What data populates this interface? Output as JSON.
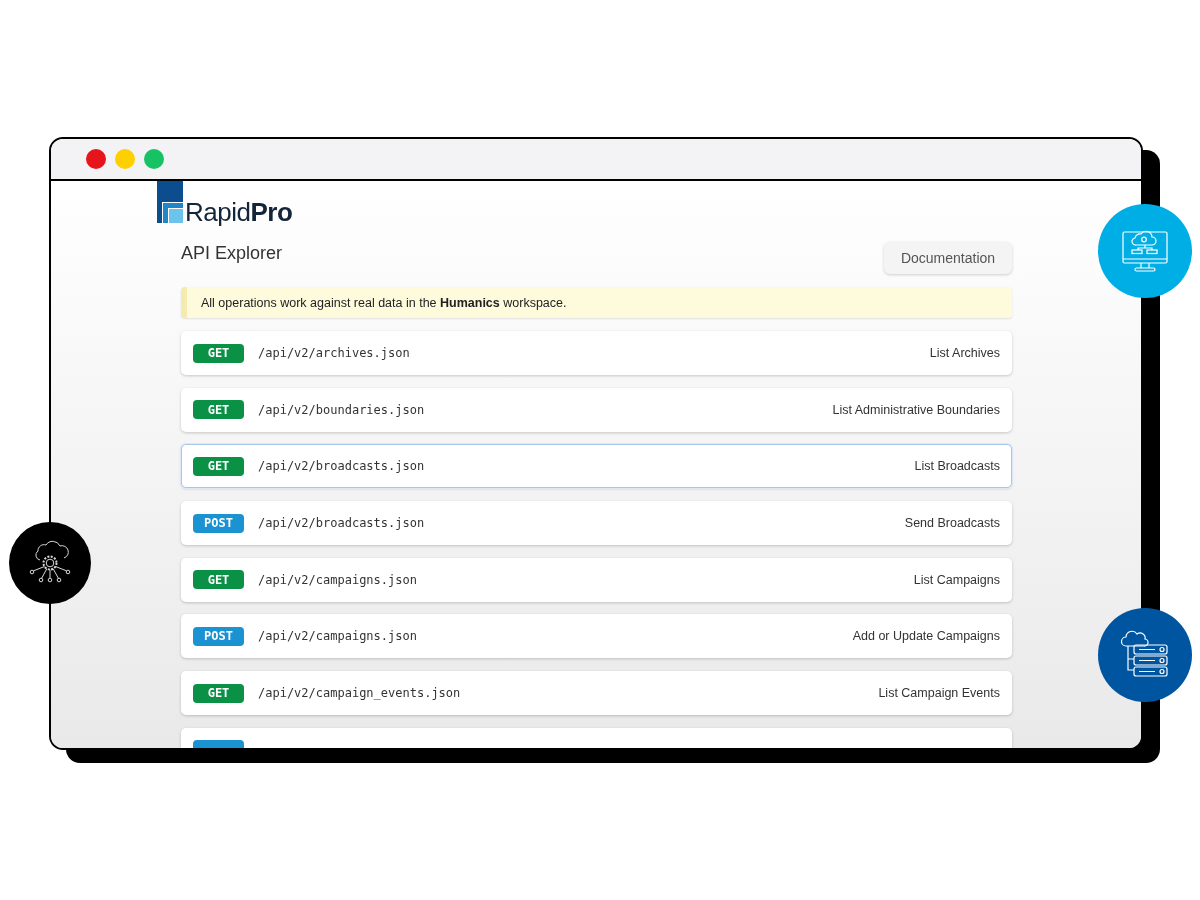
{
  "window": {
    "controls": [
      {
        "color": "#e8141c"
      },
      {
        "color": "#ffd000"
      },
      {
        "color": "#17c265"
      }
    ]
  },
  "logo": {
    "text": "Rapid**Pro**"
  },
  "page": {
    "title": "API Explorer",
    "documentation_button": "Documentation",
    "notice": "All operations work against real data in the **Humanics** workspace."
  },
  "endpoints": [
    {
      "method": "GET",
      "color": "#0b9146",
      "path": "/api/v2/archives.json",
      "description": "List Archives",
      "selected": false
    },
    {
      "method": "GET",
      "color": "#0b9146",
      "path": "/api/v2/boundaries.json",
      "description": "List Administrative Boundaries",
      "selected": false
    },
    {
      "method": "GET",
      "color": "#0b9146",
      "path": "/api/v2/broadcasts.json",
      "description": "List Broadcasts",
      "selected": true
    },
    {
      "method": "POST",
      "color": "#1b93d2",
      "path": "/api/v2/broadcasts.json",
      "description": "Send Broadcasts",
      "selected": false
    },
    {
      "method": "GET",
      "color": "#0b9146",
      "path": "/api/v2/campaigns.json",
      "description": "List Campaigns",
      "selected": false
    },
    {
      "method": "POST",
      "color": "#1b93d2",
      "path": "/api/v2/campaigns.json",
      "description": "Add or Update Campaigns",
      "selected": false
    },
    {
      "method": "GET",
      "color": "#0b9146",
      "path": "/api/v2/campaign_events.json",
      "description": "List Campaign Events",
      "selected": false
    },
    {
      "color": "#1b93d2",
      "selected": false
    }
  ]
}
